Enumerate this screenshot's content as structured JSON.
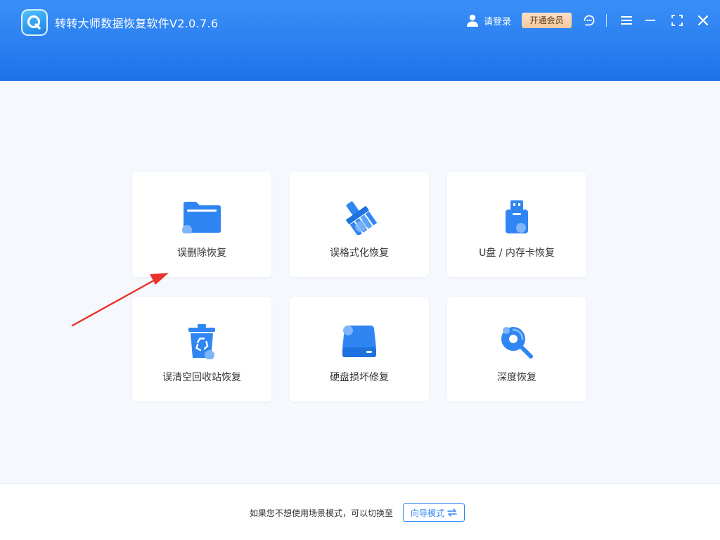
{
  "app": {
    "title": "转转大师数据恢复软件V2.0.7.6",
    "logo_icon": "q-logo-icon"
  },
  "header": {
    "login_label": "请登录",
    "vip_label": "开通会员",
    "icons": [
      "support-icon",
      "menu-icon",
      "minimize-icon",
      "maximize-icon",
      "close-icon"
    ]
  },
  "modes": [
    {
      "label": "误删除恢复",
      "icon": "folder-icon"
    },
    {
      "label": "误格式化恢复",
      "icon": "broom-icon"
    },
    {
      "label": "U盘 / 内存卡恢复",
      "icon": "usb-drive-icon"
    },
    {
      "label": "误清空回收站恢复",
      "icon": "recycle-bin-icon"
    },
    {
      "label": "硬盘损坏修复",
      "icon": "hard-disk-icon"
    },
    {
      "label": "深度恢复",
      "icon": "deep-scan-icon"
    }
  ],
  "footer": {
    "hint": "如果您不想使用场景模式，可以切换至",
    "wizard_label": "向导模式"
  },
  "colors": {
    "header": "#2a7ef0",
    "accent": "#2f86f3",
    "background": "#f5f8fc",
    "vip": "#f3c89d",
    "arrow": "#e8322b"
  }
}
